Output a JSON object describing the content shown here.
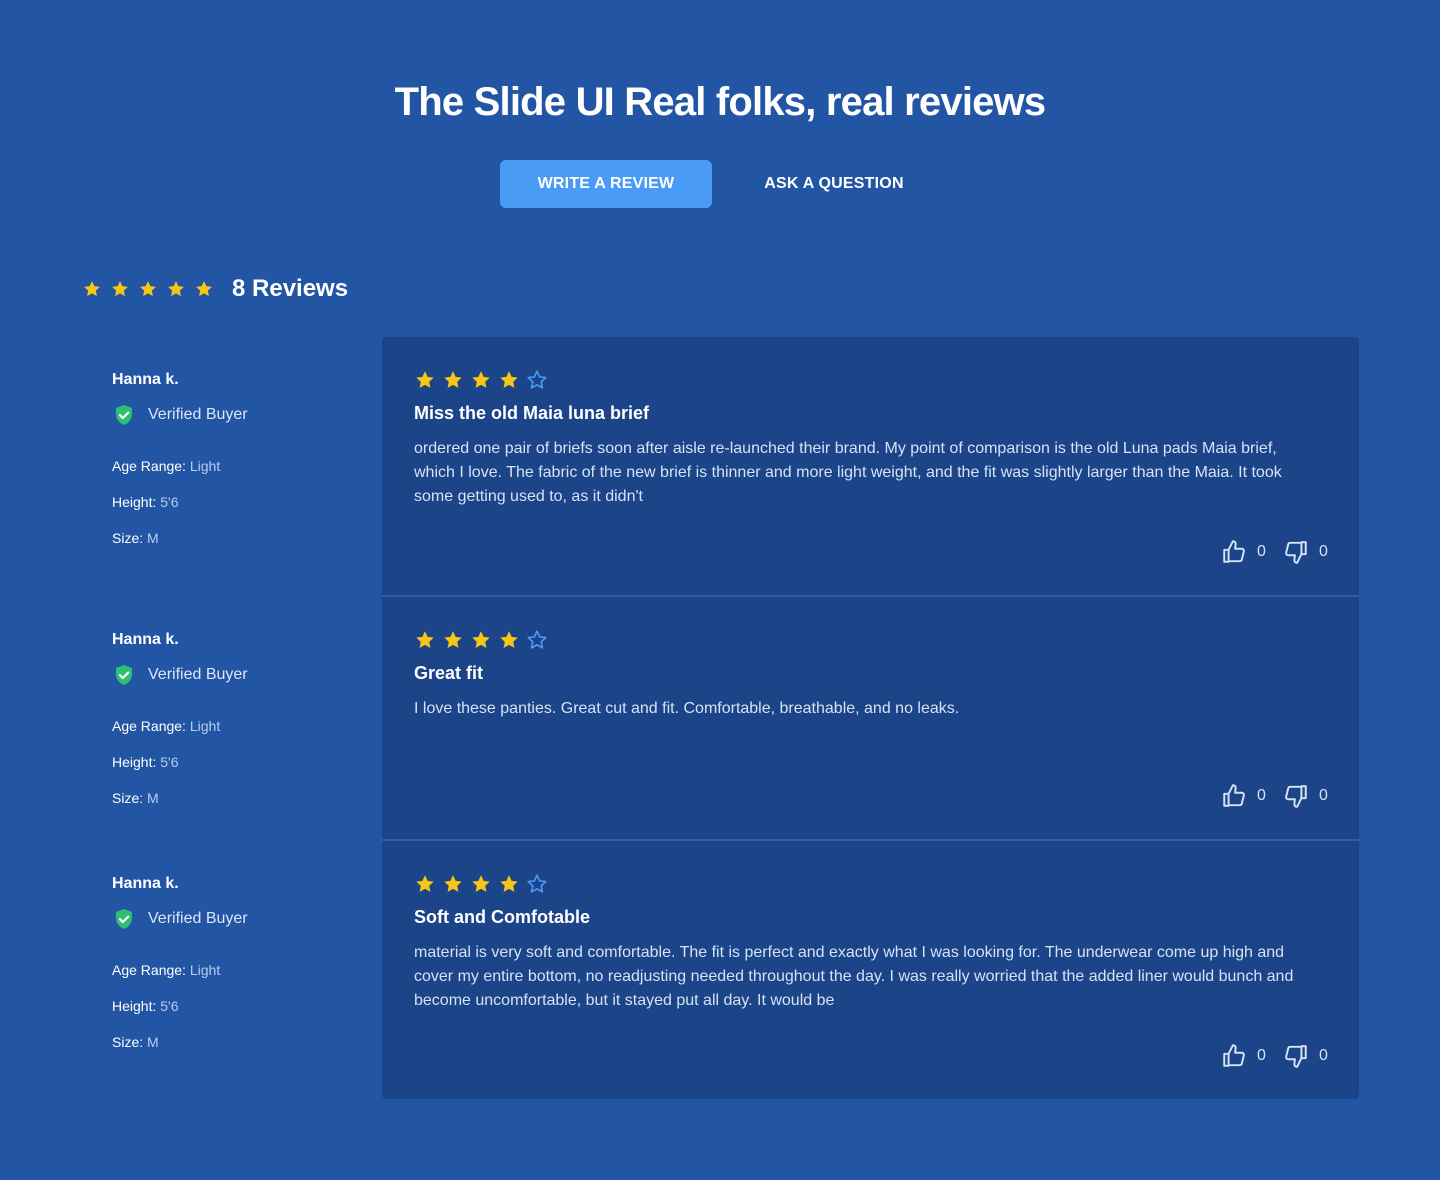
{
  "header": {
    "title": "The Slide UI Real folks, real reviews",
    "write_review_label": "WRITE A REVIEW",
    "ask_question_label": "ASK A QUESTION"
  },
  "summary": {
    "rating": 5,
    "reviews_label": "8 Reviews"
  },
  "colors": {
    "background": "#2355a5",
    "card": "#1c4488",
    "primary_button": "#4a9bf5",
    "star_filled": "#f5c518",
    "star_empty": "#4a9bf5",
    "verified": "#2fbf71"
  },
  "reviews": [
    {
      "author": "Hanna k.",
      "verified_label": "Verified Buyer",
      "age_range_label": "Age Range:",
      "age_range": "Light",
      "height_label": "Height:",
      "height": "5'6",
      "size_label": "Size:",
      "size": "M",
      "rating": 4,
      "title": "Miss the old Maia luna brief",
      "body": "ordered one pair of briefs soon after aisle re-launched their brand. My point of comparison is the old Luna pads Maia brief, which I love. The fabric of the new brief is thinner and more light weight, and the fit was slightly larger than the Maia. It took some getting used to, as it didn't",
      "helpful": "0",
      "unhelpful": "0"
    },
    {
      "author": "Hanna k.",
      "verified_label": "Verified Buyer",
      "age_range_label": "Age Range:",
      "age_range": "Light",
      "height_label": "Height:",
      "height": "5'6",
      "size_label": "Size:",
      "size": "M",
      "rating": 4,
      "title": "Great fit",
      "body": "I love these panties. Great cut and fit. Comfortable, breathable, and no leaks.",
      "helpful": "0",
      "unhelpful": "0"
    },
    {
      "author": "Hanna k.",
      "verified_label": "Verified Buyer",
      "age_range_label": "Age Range:",
      "age_range": "Light",
      "height_label": "Height:",
      "height": "5'6",
      "size_label": "Size:",
      "size": "M",
      "rating": 4,
      "title": "Soft and Comfotable",
      "body": "material is very soft and comfortable. The fit is perfect and exactly what I was looking for. The underwear come up high and cover my entire bottom, no readjusting needed throughout the day. I was really worried that the added liner would bunch and become uncomfortable, but it stayed put all day. It would be",
      "helpful": "0",
      "unhelpful": "0"
    }
  ]
}
